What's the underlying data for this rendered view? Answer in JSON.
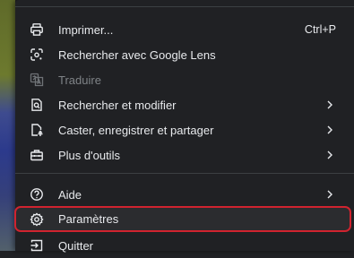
{
  "menu": {
    "items": [
      {
        "id": "print",
        "label": "Imprimer...",
        "shortcut": "Ctrl+P",
        "icon": "printer-icon"
      },
      {
        "id": "lens",
        "label": "Rechercher avec Google Lens",
        "icon": "google-lens-icon"
      },
      {
        "id": "translate",
        "label": "Traduire",
        "icon": "translate-icon",
        "disabled": true
      },
      {
        "id": "find",
        "label": "Rechercher et modifier",
        "icon": "find-page-icon",
        "submenu": true
      },
      {
        "id": "cast",
        "label": "Caster, enregistrer et partager",
        "icon": "cast-save-share-icon",
        "submenu": true
      },
      {
        "id": "tools",
        "label": "Plus d'outils",
        "icon": "toolbox-icon",
        "submenu": true
      },
      {
        "id": "help",
        "label": "Aide",
        "icon": "help-icon",
        "submenu": true
      },
      {
        "id": "settings",
        "label": "Paramètres",
        "icon": "gear-icon",
        "highlighted": true
      },
      {
        "id": "quit",
        "label": "Quitter",
        "icon": "exit-icon"
      }
    ]
  },
  "colors": {
    "menu_background": "#202124",
    "text": "#e8eaed",
    "disabled_text": "#7f8387",
    "separator": "#3c4043",
    "highlight_border": "#d0232f"
  }
}
